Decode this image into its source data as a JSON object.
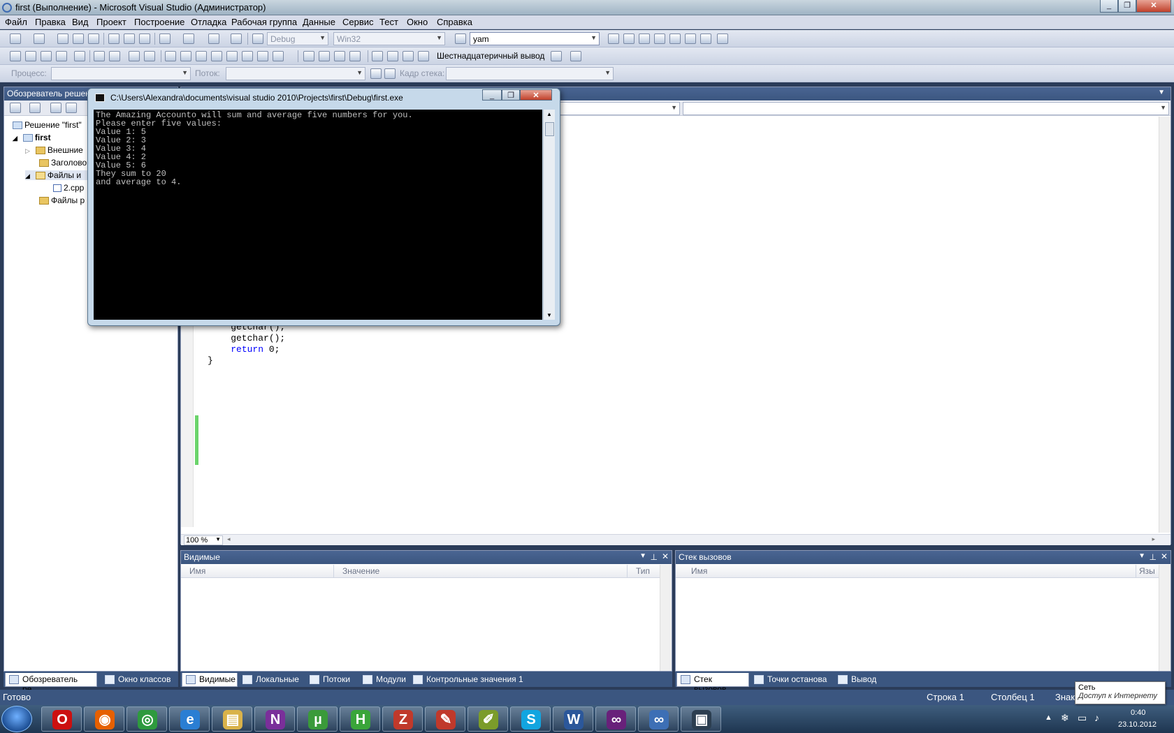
{
  "window": {
    "title": "first (Выполнение) - Microsoft Visual Studio (Администратор)"
  },
  "menu": [
    "Файл",
    "Правка",
    "Вид",
    "Проект",
    "Построение",
    "Отладка",
    "Рабочая группа",
    "Данные",
    "Сервис",
    "Тест",
    "Окно",
    "Справка"
  ],
  "toolbar1": {
    "config": "Debug",
    "platform": "Win32",
    "search": "yam"
  },
  "toolbar2": {
    "hex_label": "Шестнадцатеричный вывод"
  },
  "toolbar3": {
    "process_label": "Процесс:",
    "thread_label": "Поток:",
    "stack_label": "Кадр стека:"
  },
  "solution_explorer": {
    "title": "Обозреватель решен",
    "items": [
      {
        "label": "Решение \"first\""
      },
      {
        "label": "first"
      },
      {
        "label": "Внешние"
      },
      {
        "label": "Заголово"
      },
      {
        "label": "Файлы и"
      },
      {
        "label": "2.cpp"
      },
      {
        "label": "Файлы р"
      }
    ]
  },
  "editor": {
    "code": [
      "    getchar();",
      "    getchar();",
      "    return 0;",
      "}"
    ],
    "return_kw": "return",
    "return_rest": " 0;",
    "zoom": "100 %"
  },
  "console": {
    "title": "C:\\Users\\Alexandra\\documents\\visual studio 2010\\Projects\\first\\Debug\\first.exe",
    "output": "The Amazing Accounto will sum and average five numbers for you.\nPlease enter five values:\nValue 1: 5\nValue 2: 3\nValue 3: 4\nValue 4: 2\nValue 5: 6\nThey sum to 20\nand average to 4."
  },
  "locals_panel": {
    "title": "Видимые",
    "columns": [
      "Имя",
      "Значение",
      "Тип"
    ]
  },
  "callstack_panel": {
    "title": "Стек вызовов",
    "columns": [
      "Имя",
      "Язы"
    ]
  },
  "left_tabs": [
    "Обозреватель ре...",
    "Окно классов"
  ],
  "middle_tabs": [
    "Видимые",
    "Локальные",
    "Потоки",
    "Модули",
    "Контрольные значения 1"
  ],
  "right_tabs": [
    "Стек вызовов",
    "Точки останова",
    "Вывод"
  ],
  "statusbar": {
    "ready": "Готово",
    "line": "Строка 1",
    "col": "Столбец 1",
    "char": "Знак"
  },
  "tooltip": {
    "line1": "Сеть",
    "line2": "Доступ к Интернету"
  },
  "tray": {
    "time": "0:40",
    "date": "23.10.2012"
  },
  "taskbar_apps": [
    {
      "icon": "opera-icon",
      "glyph": "O",
      "color": "#cc1010"
    },
    {
      "icon": "firefox-icon",
      "glyph": "◉",
      "color": "#e66000"
    },
    {
      "icon": "chrome-icon",
      "glyph": "◎",
      "color": "#2e9a3e"
    },
    {
      "icon": "ie-icon",
      "glyph": "e",
      "color": "#2a7ed3"
    },
    {
      "icon": "explorer-icon",
      "glyph": "▤",
      "color": "#d9b24a"
    },
    {
      "icon": "onenote-icon",
      "glyph": "N",
      "color": "#7a2f9a"
    },
    {
      "icon": "utorrent-icon",
      "glyph": "µ",
      "color": "#3a9a3a"
    },
    {
      "icon": "html-editor-icon",
      "glyph": "H",
      "color": "#3aa53a"
    },
    {
      "icon": "filezilla-icon",
      "glyph": "Z",
      "color": "#c0392b"
    },
    {
      "icon": "pdf-icon",
      "glyph": "✎",
      "color": "#c0392b"
    },
    {
      "icon": "notepad-icon",
      "glyph": "✐",
      "color": "#7b9c2a"
    },
    {
      "icon": "skype-icon",
      "glyph": "S",
      "color": "#12a5e0"
    },
    {
      "icon": "word-icon",
      "glyph": "W",
      "color": "#2b579a"
    },
    {
      "icon": "visual-studio-icon",
      "glyph": "∞",
      "color": "#68217a"
    },
    {
      "icon": "vs-infinity-icon",
      "glyph": "∞",
      "color": "#3d6fb5"
    },
    {
      "icon": "console-icon",
      "glyph": "▣",
      "color": "#2c3e50"
    }
  ]
}
